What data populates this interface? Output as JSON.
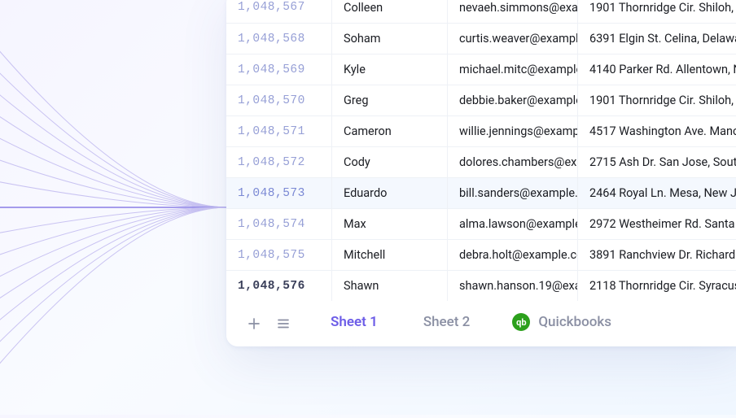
{
  "colors": {
    "accent": "#6c5ce7",
    "row_number": "#969fd6",
    "quickbooks": "#2ca01c"
  },
  "rows": [
    {
      "rn": "1,048,567",
      "name": "Colleen",
      "email": "nevaeh.simmons@exar",
      "addr": "1901 Thornridge Cir. Shiloh, "
    },
    {
      "rn": "1,048,568",
      "name": "Soham",
      "email": "curtis.weaver@example",
      "addr": "6391 Elgin St. Celina, Delawa"
    },
    {
      "rn": "1,048,569",
      "name": "Kyle",
      "email": "michael.mitc@example",
      "addr": "4140 Parker Rd. Allentown, N"
    },
    {
      "rn": "1,048,570",
      "name": "Greg",
      "email": "debbie.baker@example",
      "addr": "1901 Thornridge Cir. Shiloh, H"
    },
    {
      "rn": "1,048,571",
      "name": "Cameron",
      "email": "willie.jennings@examp",
      "addr": "4517 Washington Ave. Mancl"
    },
    {
      "rn": "1,048,572",
      "name": "Cody",
      "email": "dolores.chambers@exa",
      "addr": "2715 Ash Dr. San Jose, South"
    },
    {
      "rn": "1,048,573",
      "name": "Eduardo",
      "email": "bill.sanders@example.",
      "addr": "2464 Royal Ln. Mesa, New Je",
      "highlight": true
    },
    {
      "rn": "1,048,574",
      "name": "Max",
      "email": "alma.lawson@example",
      "addr": "2972 Westheimer Rd. Santa "
    },
    {
      "rn": "1,048,575",
      "name": "Mitchell",
      "email": "debra.holt@example.co",
      "addr": "3891 Ranchview Dr. Richards"
    },
    {
      "rn": "1,048,576",
      "name": "Shawn",
      "email": "shawn.hanson.19@exa",
      "addr": "2118 Thornridge Cir. Syracus",
      "bold": true
    }
  ],
  "tabs": {
    "sheet1": "Sheet 1",
    "sheet2": "Sheet 2",
    "quickbooks_label": "Quickbooks",
    "quickbooks_badge": "qb"
  },
  "icons": {
    "plus": "plus-icon",
    "menu": "menu-icon"
  }
}
